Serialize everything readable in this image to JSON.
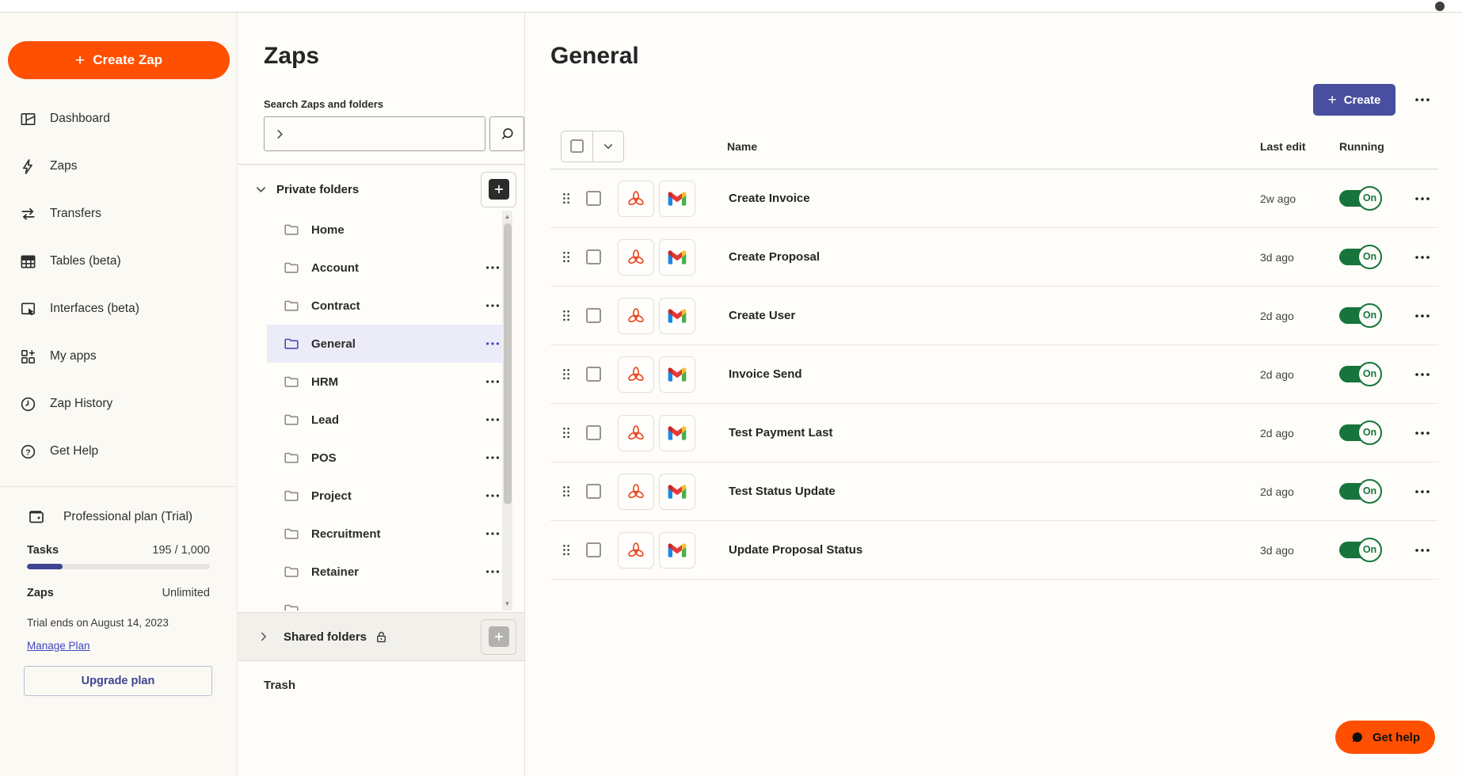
{
  "colors": {
    "brand_orange": "#ff4f00",
    "button_indigo": "#474f9e",
    "progress_indigo": "#3d4592",
    "link_blue": "#3f48c0",
    "toggle_green": "#17753c",
    "selected_folder_bg": "#ececf9"
  },
  "sidebar": {
    "create_zap_label": "Create Zap",
    "nav": [
      {
        "label": "Dashboard",
        "icon": "dashboard-icon"
      },
      {
        "label": "Zaps",
        "icon": "lightning-icon"
      },
      {
        "label": "Transfers",
        "icon": "transfers-icon"
      },
      {
        "label": "Tables (beta)",
        "icon": "table-icon"
      },
      {
        "label": "Interfaces (beta)",
        "icon": "interfaces-icon"
      },
      {
        "label": "My apps",
        "icon": "apps-grid-icon"
      },
      {
        "label": "Zap History",
        "icon": "clock-icon"
      },
      {
        "label": "Get Help",
        "icon": "question-circle-icon"
      }
    ],
    "plan": {
      "title": "Professional plan (Trial)",
      "tasks_label": "Tasks",
      "tasks_value": "195 / 1,000",
      "tasks_pct": 19.5,
      "zaps_label": "Zaps",
      "zaps_value": "Unlimited",
      "trial_note": "Trial ends on August 14, 2023",
      "manage_link": "Manage Plan",
      "upgrade_label": "Upgrade plan"
    }
  },
  "folder_panel": {
    "title": "Zaps",
    "search_label": "Search Zaps and folders",
    "search_value": "",
    "private_folders_label": "Private folders",
    "shared_folders_label": "Shared folders",
    "trash_label": "Trash",
    "folders": [
      {
        "name": "Home",
        "menu": false,
        "selected": false,
        "partial": false
      },
      {
        "name": "Account",
        "menu": true,
        "selected": false,
        "partial": false
      },
      {
        "name": "Contract",
        "menu": true,
        "selected": false,
        "partial": false
      },
      {
        "name": "General",
        "menu": true,
        "selected": true,
        "partial": false
      },
      {
        "name": "HRM",
        "menu": true,
        "selected": false,
        "partial": false
      },
      {
        "name": "Lead",
        "menu": true,
        "selected": false,
        "partial": false
      },
      {
        "name": "POS",
        "menu": true,
        "selected": false,
        "partial": false
      },
      {
        "name": "Project",
        "menu": true,
        "selected": false,
        "partial": false
      },
      {
        "name": "Recruitment",
        "menu": true,
        "selected": false,
        "partial": false
      },
      {
        "name": "Retainer",
        "menu": true,
        "selected": false,
        "partial": false
      },
      {
        "name": "",
        "menu": false,
        "selected": false,
        "partial": true
      }
    ]
  },
  "main": {
    "title": "General",
    "create_button_label": "Create",
    "columns": {
      "name": "Name",
      "last_edit": "Last edit",
      "running": "Running"
    },
    "zaps": [
      {
        "name": "Create Invoice",
        "app_icons": [
          "zoho-trefoil",
          "gmail"
        ],
        "last_edit": "2w ago",
        "running": "On"
      },
      {
        "name": "Create Proposal",
        "app_icons": [
          "zoho-trefoil",
          "gmail"
        ],
        "last_edit": "3d ago",
        "running": "On"
      },
      {
        "name": "Create User",
        "app_icons": [
          "zoho-trefoil",
          "gmail"
        ],
        "last_edit": "2d ago",
        "running": "On"
      },
      {
        "name": "Invoice Send",
        "app_icons": [
          "zoho-trefoil",
          "gmail"
        ],
        "last_edit": "2d ago",
        "running": "On"
      },
      {
        "name": "Test Payment Last",
        "app_icons": [
          "zoho-trefoil",
          "gmail"
        ],
        "last_edit": "2d ago",
        "running": "On"
      },
      {
        "name": "Test Status Update",
        "app_icons": [
          "zoho-trefoil",
          "gmail"
        ],
        "last_edit": "2d ago",
        "running": "On"
      },
      {
        "name": "Update Proposal Status",
        "app_icons": [
          "zoho-trefoil",
          "gmail"
        ],
        "last_edit": "3d ago",
        "running": "On"
      }
    ]
  },
  "help_button_label": "Get help"
}
